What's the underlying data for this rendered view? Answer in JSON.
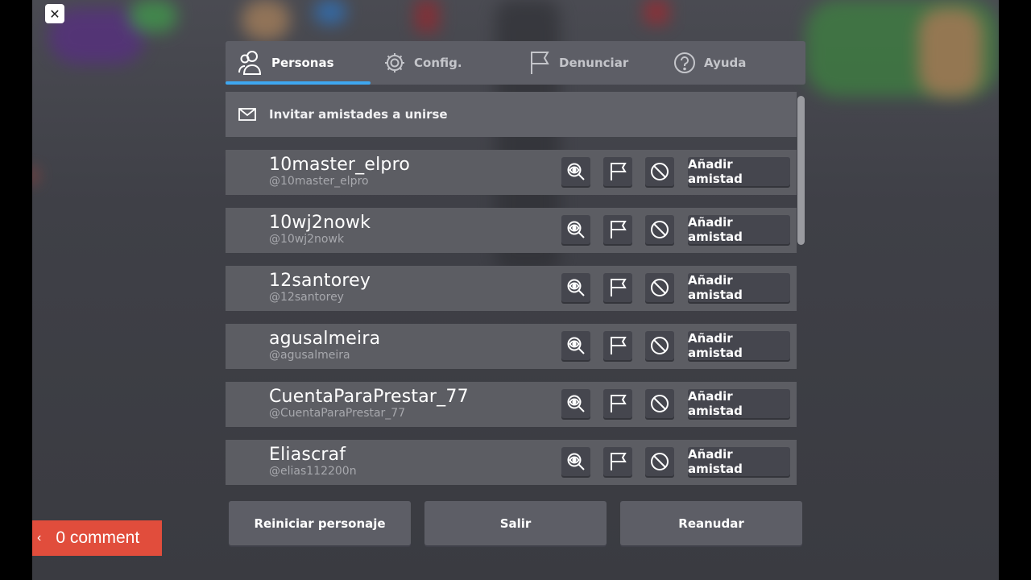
{
  "tabs": [
    {
      "label": "Personas",
      "icon": "people-icon",
      "active": true
    },
    {
      "label": "Config.",
      "icon": "gear-icon",
      "active": false
    },
    {
      "label": "Denunciar",
      "icon": "flag-icon",
      "active": false
    },
    {
      "label": "Ayuda",
      "icon": "help-icon",
      "active": false
    }
  ],
  "invite": {
    "label": "Invitar amistades a unirse",
    "icon": "mail-icon"
  },
  "players": [
    {
      "name": "10master_elpro",
      "handle": "@10master_elpro",
      "add_label": "Añadir amistad"
    },
    {
      "name": "10wj2nowk",
      "handle": "@10wj2nowk",
      "add_label": "Añadir amistad"
    },
    {
      "name": "12santorey",
      "handle": "@12santorey",
      "add_label": "Añadir amistad"
    },
    {
      "name": "agusalmeira",
      "handle": "@agusalmeira",
      "add_label": "Añadir amistad"
    },
    {
      "name": "CuentaParaPrestar_77",
      "handle": "@CuentaParaPrestar_77",
      "add_label": "Añadir amistad"
    },
    {
      "name": "Eliascraf",
      "handle": "@elias112200n",
      "add_label": "Añadir amistad"
    }
  ],
  "bottom": {
    "reset": "Reiniciar personaje",
    "leave": "Salir",
    "resume": "Reanudar"
  },
  "close_glyph": "✕",
  "comment": {
    "chevron": "‹",
    "text": "0 comment"
  },
  "colors": {
    "accent": "#3ea7f0",
    "comment_bg": "#e14d3c"
  }
}
